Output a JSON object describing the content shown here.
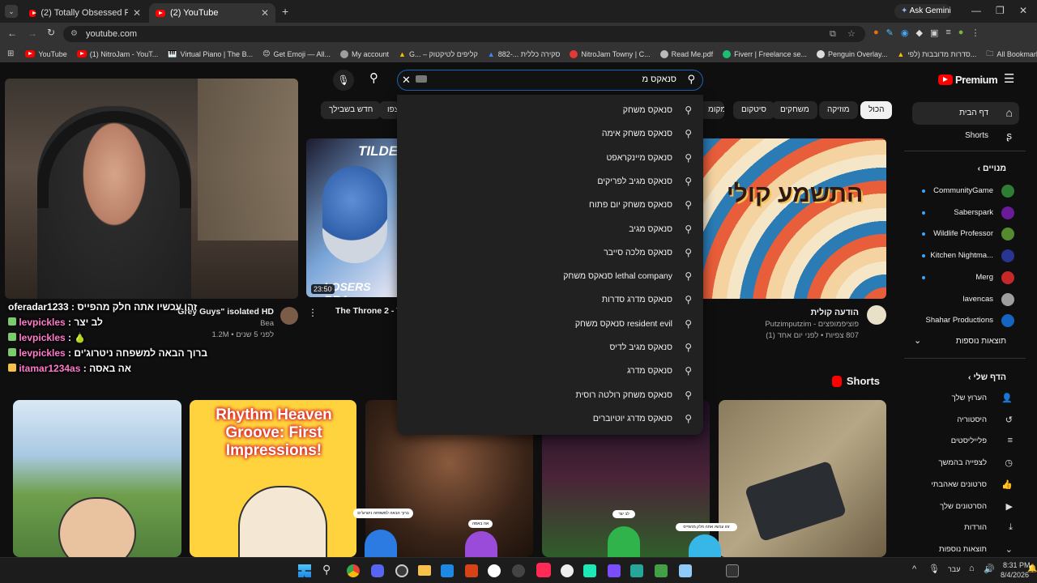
{
  "browser": {
    "tabs": [
      {
        "title": "(2) Totally Obsessed Pac-Man -"
      },
      {
        "title": "(2) YouTube"
      }
    ],
    "ask_gemini": "Ask Gemini",
    "url": "youtube.com",
    "bookmarks": [
      "YouTube",
      "(1) NitroJam - YouT...",
      "Virtual Piano | The B...",
      "Get Emoji — All...",
      "My account",
      "G... – קליפים לטיקטוק",
      "882-... סקירה כללית",
      "NitroJam Towny | C...",
      "Read Me.pdf",
      "Fiverr | Freelance se...",
      "Penguin Overlay...",
      "סדרות מדובבות (לפי...",
      "All Bookmarks"
    ]
  },
  "youtube": {
    "premium_label": "Premium",
    "search": {
      "query": "סנאקס מ",
      "placeholder": ""
    },
    "suggestions": [
      "סנאקס משחק",
      "סנאקס משחק אימה",
      "סנאקס מיינקראפט",
      "סנאקס מגיב לפריקים",
      "סנאקס משחק יום פתוח",
      "סנאקס מגיב",
      "סנאקס מלכה סייבר",
      "lethal company סנאקס משחק",
      "סנאקס מדרג סדרות",
      "resident evil סנאקס משחק",
      "סנאקס מגיב לדיס",
      "סנאקס מדרג",
      "סנאקס משחק רולטה רוסית",
      "סנאקס מדרג יוטיוברים"
    ],
    "chips": [
      "הכול",
      "מוזיקה",
      "משחקים",
      "סיטקום",
      "מקומ",
      "צפו",
      "חדש בשבילך"
    ],
    "sidebar": {
      "home": "דף הבית",
      "shorts": "Shorts",
      "subs_header": "מנויים",
      "subs": [
        "CommunityGame",
        "Saberspark",
        "Wildlife Professor",
        "Kitchen Nightma...",
        "Merg",
        "lavencas",
        "Shahar Productions"
      ],
      "show_more": "תוצאות נוספות",
      "you_header": "הדף שלי",
      "you_items": [
        "הערוץ שלך",
        "היסטוריה",
        "פלייליסטים",
        "לצפייה בהמשך",
        "סרטונים שאהבתי",
        "הסרטונים שלך",
        "הורדות",
        "תוצאות נוספות"
      ]
    },
    "videos": [
      {
        "title": "\"Grey Guys\" isolated HD",
        "channel": "Bea",
        "meta": "1.2M • לפני 5 שנים"
      },
      {
        "title": "The Throne 2 - T",
        "thumb_text": "TILDE",
        "thumb_text2": "LOSERS BRA",
        "duration": "23:50"
      },
      {
        "title": "הודעה קולית",
        "channel": "פוציפמופצים - Putzimputzim",
        "meta": "807 צפיות • לפני יום אחד (1)",
        "thumb_text": "התשמע קולי"
      }
    ],
    "shorts_label": "Shorts",
    "shorts": [
      {
        "title": ""
      },
      {
        "title": "Rhythm Heaven Groove: First Impressions!"
      },
      {
        "title": ""
      },
      {
        "title": ""
      },
      {
        "title": ""
      }
    ]
  },
  "chat": [
    {
      "user": "oferadar1233",
      "msg": "זהו עכשיו אתה חלק מהפייס"
    },
    {
      "user": "levpickles",
      "msg": "לב יצר"
    },
    {
      "user": "levpickles",
      "msg": "🍐"
    },
    {
      "user": "levpickles",
      "msg": "ברוך הבאה למשפחה ניטרוג'ים"
    },
    {
      "user": "itamar1234as",
      "msg": "אה באסה"
    }
  ],
  "penguin_bubbles": [
    "ברוך הבאה למשפחה ניטרוג'ים",
    "אה באסה",
    "לב יצר",
    "זהו עכשיו אתה חלק מהפייס"
  ],
  "taskbar": {
    "lang": "עבר",
    "time": "8:31 PM",
    "date": "8/4/2026"
  }
}
